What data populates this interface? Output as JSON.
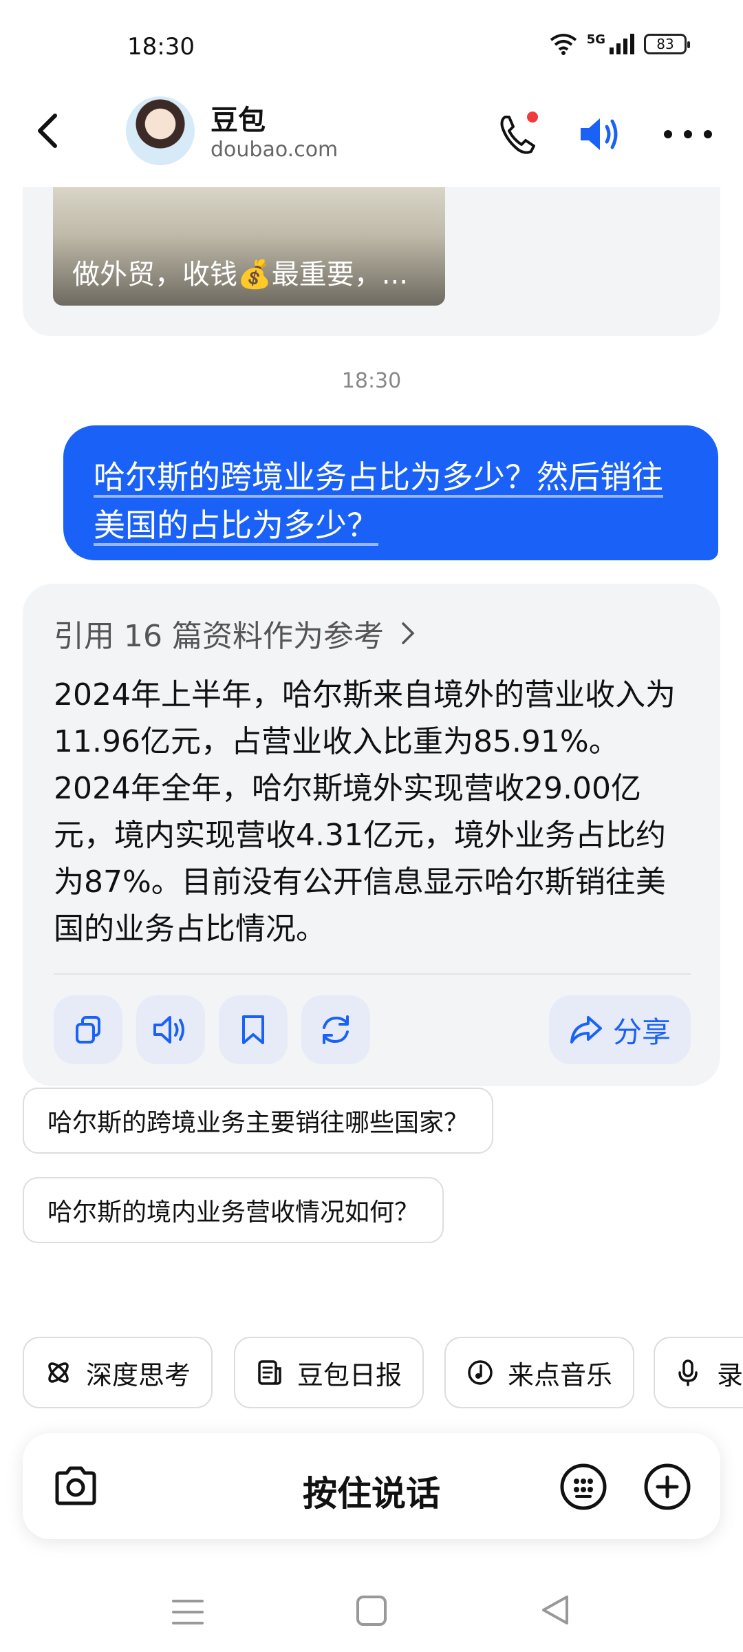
{
  "status_bar": {
    "time": "18:30",
    "network": "5G",
    "battery": "83"
  },
  "header": {
    "name": "豆包",
    "subtitle": "doubao.com"
  },
  "previous_message": {
    "caption": "做外贸，收钱💰最重要，..."
  },
  "timestamp": "18:30",
  "user_message": "哈尔斯的跨境业务占比为多少？然后销往美国的占比为多少？",
  "answer": {
    "references": "引用 16 篇资料作为参考",
    "text": "2024年上半年，哈尔斯来自境外的营业收入为11.96亿元，占营业收入比重为85.91%。2024年全年，哈尔斯境外实现营收29.00亿元，境内实现营收4.31亿元，境外业务占比约为87%。目前没有公开信息显示哈尔斯销往美国的业务占比情况。",
    "share_label": "分享"
  },
  "suggestions": [
    "哈尔斯的跨境业务主要销往哪些国家？",
    "哈尔斯的境内业务营收情况如何？"
  ],
  "quick_actions": [
    "深度思考",
    "豆包日报",
    "来点音乐",
    "录"
  ],
  "input": {
    "hold_to_talk": "按住说话"
  },
  "colors": {
    "accent": "#1a62f7",
    "card_bg": "#f3f4f6",
    "action_bg": "#e6ebf7"
  }
}
